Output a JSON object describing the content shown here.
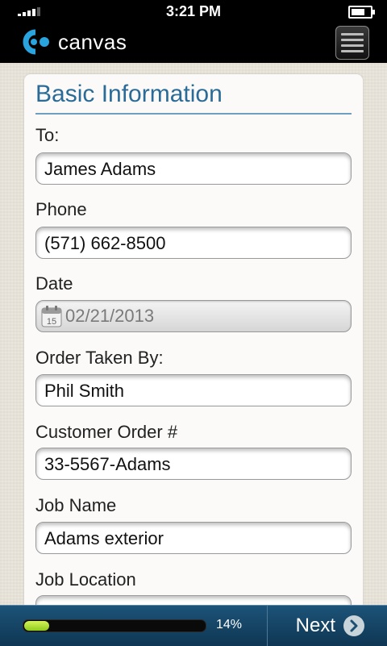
{
  "status_bar": {
    "time": "3:21 PM"
  },
  "header": {
    "brand": "canvas"
  },
  "form": {
    "section_title": "Basic Information",
    "fields": [
      {
        "label": "To:",
        "value": "James Adams"
      },
      {
        "label": "Phone",
        "value": "(571) 662-8500"
      },
      {
        "label": "Date",
        "value": "02/21/2013"
      },
      {
        "label": "Order Taken By:",
        "value": "Phil Smith"
      },
      {
        "label": "Customer Order #",
        "value": "33-5567-Adams"
      },
      {
        "label": "Job Name",
        "value": "Adams exterior"
      },
      {
        "label": "Job Location",
        "value": ""
      }
    ],
    "calendar_icon_day": "15"
  },
  "footer": {
    "progress_text": "14%",
    "progress_value": 0.14,
    "next_label": "Next"
  },
  "colors": {
    "accent": "#2a6b97",
    "progress": "#a6dc2a",
    "footer": "#164a6e"
  }
}
